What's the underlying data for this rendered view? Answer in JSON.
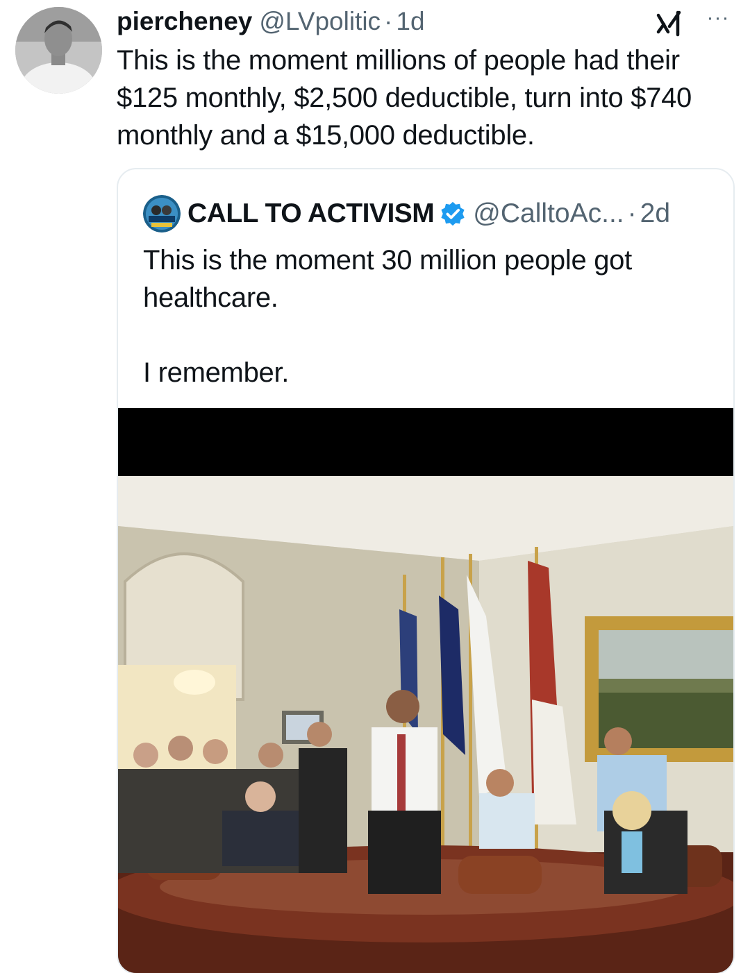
{
  "author": {
    "display_name": "piercheney",
    "handle": "@LVpolitic",
    "separator": "·",
    "time": "1d",
    "avatar_icon": "profile-photo-grayscale"
  },
  "tweet": {
    "text": "This is the moment millions of people had their $125 monthly, $2,500 deductible, turn into $740 monthly and a $15,000 deductible."
  },
  "header_icons": {
    "grok": "grok-icon",
    "more": "···"
  },
  "quote": {
    "display_name": "CALL TO ACTIVISM",
    "verified_icon": "verified-badge-icon",
    "handle": "@CalltoAc...",
    "separator": "·",
    "time": "2d",
    "text_line1": "This is the moment 30 million people got healthcare.",
    "text_line2": "I remember.",
    "media": "video-still-room-applause"
  },
  "colors": {
    "text": "#0f1419",
    "secondary": "#536471",
    "verified": "#1d9bf0",
    "border": "#e6ecf0"
  }
}
